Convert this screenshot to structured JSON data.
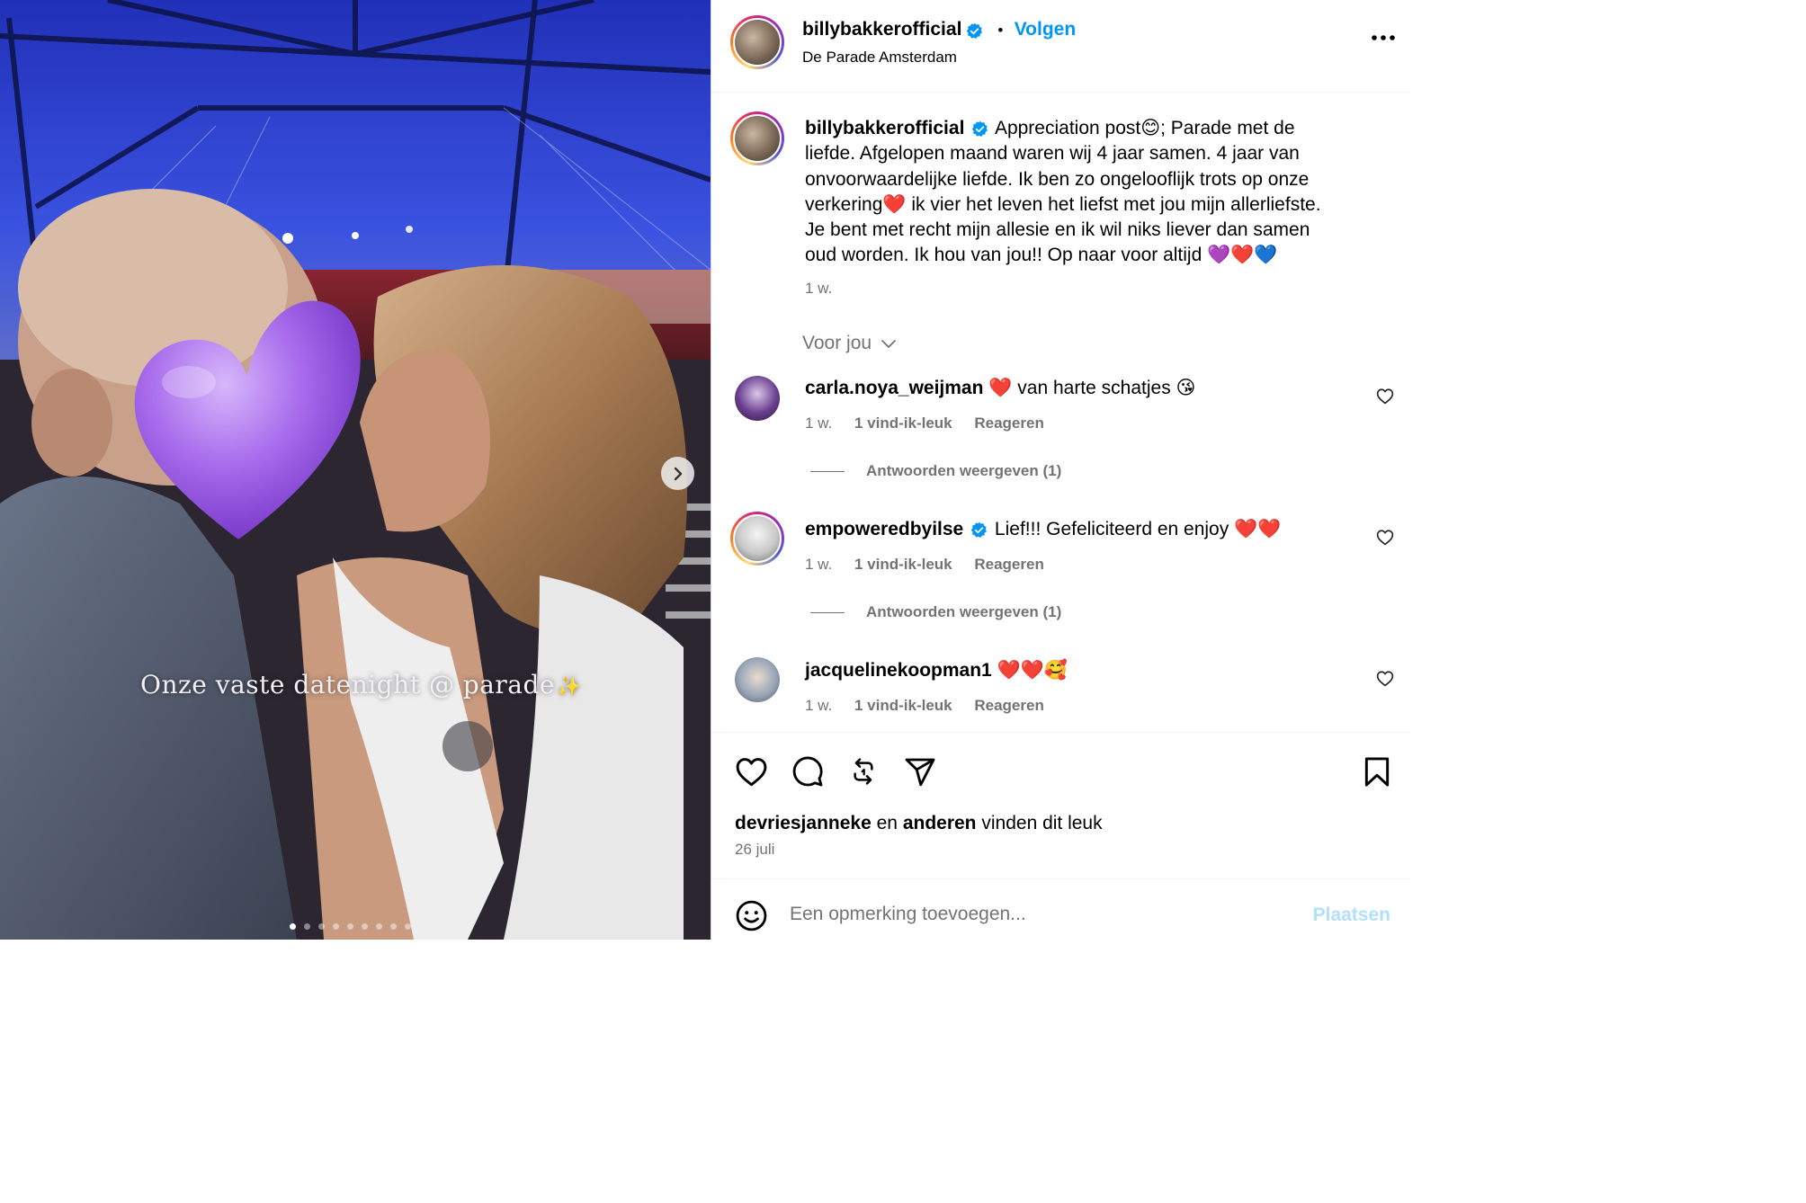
{
  "media": {
    "overlay_text": "Onze vaste datenight @ parade",
    "overlay_sparkle": "✨",
    "slide_count": 9,
    "active_slide": 1,
    "next_icon": "chevron-right-icon"
  },
  "header": {
    "username": "billybakkerofficial",
    "separator": "•",
    "follow_label": "Volgen",
    "location": "De Parade Amsterdam"
  },
  "caption": {
    "username": "billybakkerofficial",
    "lines": [
      "Appreciation post😊; Parade met de",
      "liefde. Afgelopen maand waren wij 4 jaar samen. 4 jaar van",
      "onvoorwaardelijke liefde. Ik ben zo ongelooflijk trots op onze",
      "verkering❤️ ik vier het leven het liefst met jou mijn allerliefste.",
      "Je bent met recht mijn allesie en ik wil niks liever dan samen",
      "oud worden. Ik hou van jou!! Op naar voor altijd 💜❤️💙"
    ],
    "time": "1 w."
  },
  "for_you_label": "Voor jou",
  "comments": [
    {
      "username": "carla.noya_weijman",
      "verified": false,
      "text": "❤️ van harte schatjes 😘",
      "time": "1 w.",
      "likes": "1 vind-ik-leuk",
      "reply": "Reageren",
      "view_replies": "Antwoorden weergeven (1)"
    },
    {
      "username": "empoweredbyilse",
      "verified": true,
      "text": "Lief!!! Gefeliciteerd en enjoy ❤️❤️",
      "time": "1 w.",
      "likes": "1 vind-ik-leuk",
      "reply": "Reageren",
      "view_replies": "Antwoorden weergeven (1)"
    },
    {
      "username": "jacquelinekoopman1",
      "verified": false,
      "text": "❤️❤️🥰",
      "time": "1 w.",
      "likes": "1 vind-ik-leuk",
      "reply": "Reageren"
    }
  ],
  "actions": {
    "likes_user": "devriesjanneke",
    "likes_connector": "en",
    "likes_others": "anderen",
    "likes_suffix": "vinden dit leuk",
    "date": "26 juli"
  },
  "composer": {
    "placeholder": "Een opmerking toevoegen...",
    "post_label": "Plaatsen"
  },
  "colors": {
    "link_blue": "#0095f6",
    "verified_blue": "#0095f6",
    "muted": "#737373",
    "post_disabled": "#b2dffc",
    "tent_blue": "#2f3fd0",
    "heart_purple": "#a260e6"
  }
}
